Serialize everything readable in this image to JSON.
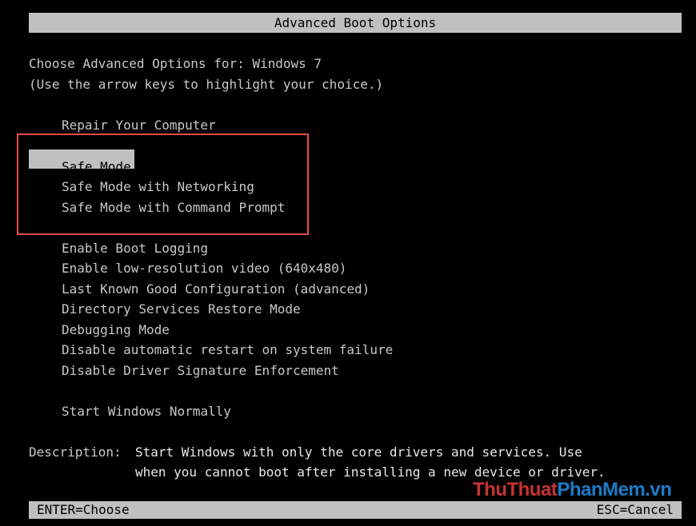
{
  "window_title": "Advanced Boot Options",
  "header": {
    "line1": "Choose Advanced Options for: Windows 7",
    "line2": "(Use the arrow keys to highlight your choice.)"
  },
  "menu": {
    "repair": "Repair Your Computer",
    "safe_mode": "Safe Mode",
    "safe_mode_networking": "Safe Mode with Networking",
    "safe_mode_command_prompt": "Safe Mode with Command Prompt",
    "enable_boot_logging": "Enable Boot Logging",
    "enable_low_res": "Enable low-resolution video (640x480)",
    "last_known_good": "Last Known Good Configuration (advanced)",
    "directory_services": "Directory Services Restore Mode",
    "debugging": "Debugging Mode",
    "disable_restart": "Disable automatic restart on system failure",
    "disable_driver_sig": "Disable Driver Signature Enforcement",
    "start_normally": "Start Windows Normally",
    "selected": "Safe Mode"
  },
  "description": {
    "label": "Description:",
    "line1": "Start Windows with only the core drivers and services. Use",
    "line2": "when you cannot boot after installing a new device or driver."
  },
  "footer": {
    "left": "ENTER=Choose",
    "right": "ESC=Cancel"
  },
  "watermark": {
    "part1": "ThuThuat",
    "part2": "PhanMem",
    "part3": ".vn"
  },
  "colors": {
    "background": "#000000",
    "text": "#c8c8c8",
    "bar": "#c0c0c0",
    "highlight_box": "#e84a4a",
    "watermark_red": "#c83232",
    "watermark_blue": "#1c7cc8"
  }
}
